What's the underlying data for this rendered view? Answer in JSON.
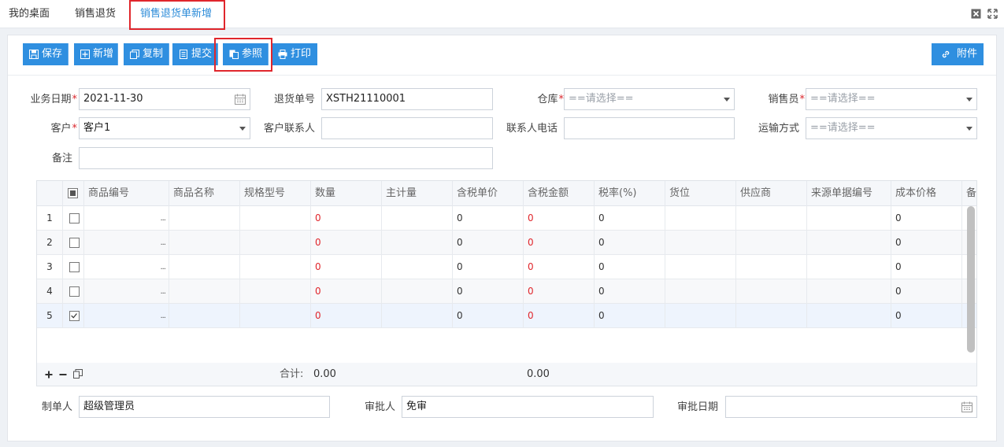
{
  "tabs": [
    {
      "label": "我的桌面"
    },
    {
      "label": "销售退货"
    },
    {
      "label": "销售退货单新增"
    }
  ],
  "toolbar": {
    "save": "保存",
    "add": "新增",
    "copy": "复制",
    "submit": "提交",
    "reference": "参照",
    "print": "打印",
    "attachment": "附件"
  },
  "form": {
    "biz_date_label": "业务日期",
    "biz_date_value": "2021-11-30",
    "return_no_label": "退货单号",
    "return_no_value": "XSTH21110001",
    "warehouse_label": "仓库",
    "warehouse_placeholder": "==请选择==",
    "salesman_label": "销售员",
    "salesman_placeholder": "==请选择==",
    "customer_label": "客户",
    "customer_value": "客户1",
    "contact_label": "客户联系人",
    "contact_value": "",
    "phone_label": "联系人电话",
    "phone_value": "",
    "transport_label": "运输方式",
    "transport_placeholder": "==请选择==",
    "remark_label": "备注",
    "remark_value": ""
  },
  "grid": {
    "columns": [
      "商品编号",
      "商品名称",
      "规格型号",
      "数量",
      "主计量",
      "含税单价",
      "含税金额",
      "税率(%)",
      "货位",
      "供应商",
      "来源单据编号",
      "成本价格",
      "备"
    ],
    "rows": [
      {
        "no": "1",
        "checked": false,
        "qty": "0",
        "price": "0",
        "amount": "0",
        "tax": "0",
        "cost": "0"
      },
      {
        "no": "2",
        "checked": false,
        "qty": "0",
        "price": "0",
        "amount": "0",
        "tax": "0",
        "cost": "0"
      },
      {
        "no": "3",
        "checked": false,
        "qty": "0",
        "price": "0",
        "amount": "0",
        "tax": "0",
        "cost": "0"
      },
      {
        "no": "4",
        "checked": false,
        "qty": "0",
        "price": "0",
        "amount": "0",
        "tax": "0",
        "cost": "0"
      },
      {
        "no": "5",
        "checked": true,
        "qty": "0",
        "price": "0",
        "amount": "0",
        "tax": "0",
        "cost": "0"
      }
    ],
    "dots": "...",
    "footer": {
      "total_label": "合计:",
      "qty_total": "0.00",
      "amount_total": "0.00"
    }
  },
  "bottom": {
    "creator_label": "制单人",
    "creator_value": "超级管理员",
    "approver_label": "审批人",
    "approver_value": "免审",
    "approve_date_label": "审批日期",
    "approve_date_value": ""
  },
  "colors": {
    "accent": "#2f8fe0",
    "highlight": "#e0262c",
    "required": "#d9242b"
  }
}
